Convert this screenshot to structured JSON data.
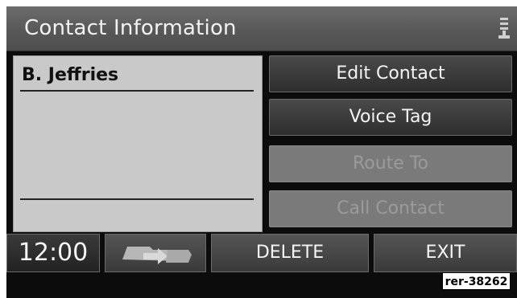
{
  "header": {
    "title": "Contact Information",
    "status_icon": "phone-settings-icon"
  },
  "contact": {
    "name": "B. Jeffries"
  },
  "actions": [
    {
      "label": "Edit Contact",
      "enabled": true
    },
    {
      "label": "Voice Tag",
      "enabled": true
    },
    {
      "label": "Route To",
      "enabled": false
    },
    {
      "label": "Call Contact",
      "enabled": false
    }
  ],
  "bottom_bar": {
    "clock": "12:00",
    "nav_icon": "navigation-return-icon",
    "delete_label": "DELETE",
    "exit_label": "EXIT"
  },
  "reference": "rer-38262",
  "colors": {
    "screen_bg": "#0c0c0c",
    "panel_bg": "#c9c9c9",
    "enabled_text": "#f4f4f4",
    "disabled_text": "#9b9b9b"
  }
}
